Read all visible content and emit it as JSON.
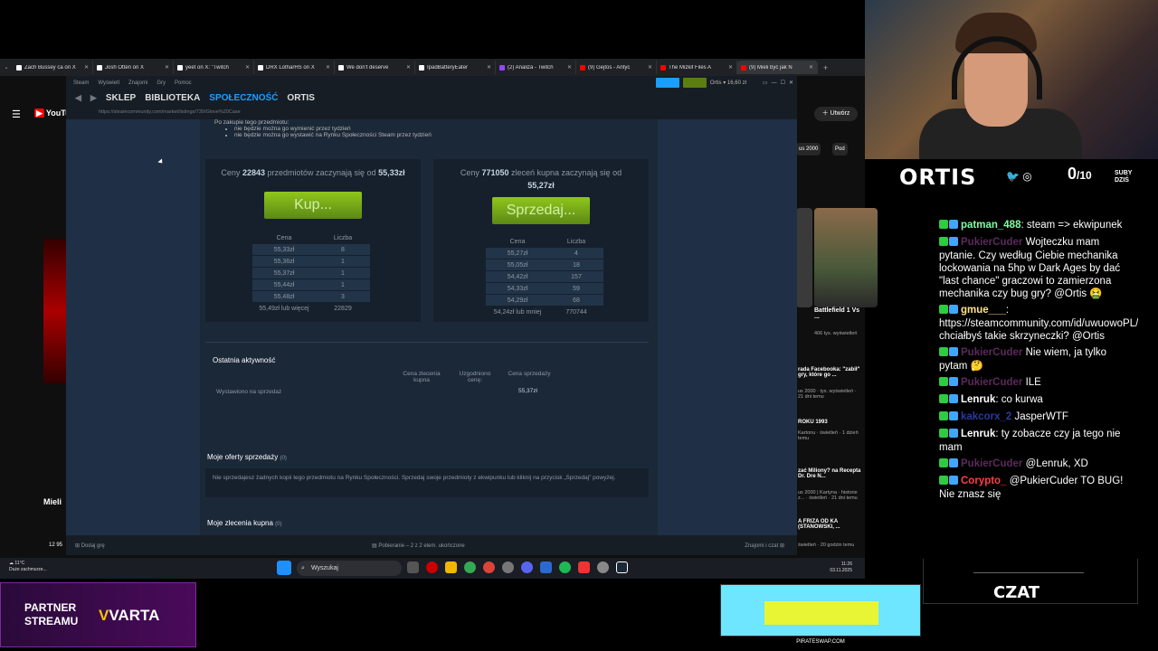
{
  "browser": {
    "tabs": [
      {
        "label": "Zach Bussey ca on X",
        "color": "#ffffff"
      },
      {
        "label": "Josh Otten on X",
        "color": "#ffffff"
      },
      {
        "label": "yeet on X: \"Twitch",
        "color": "#ffffff"
      },
      {
        "label": "DRX LotharHS on X",
        "color": "#ffffff"
      },
      {
        "label": "We don't deserve",
        "color": "#ffffff"
      },
      {
        "label": "IpadBatteryEater",
        "color": "#ffffff"
      },
      {
        "label": "(2) Analiza - Twitch",
        "color": "#9146ff"
      },
      {
        "label": "(9) Gejtos - Antyc",
        "color": "#ff0000"
      },
      {
        "label": "The Mizkif Files A",
        "color": "#ff0000"
      },
      {
        "label": "(9) Mieli być jak N",
        "color": "#ff0000"
      }
    ],
    "new_tab": "+"
  },
  "youtube": {
    "logo": "YouTube",
    "create_label": "Utwórz",
    "chip1": "us 2000",
    "chip2": "Pod",
    "video_title_left": "Mieli",
    "views_left": "12 95",
    "right_videos": [
      {
        "title": "Battlefield 1 Vs ...",
        "meta": "406 tys. wyświetleń"
      },
      {
        "title": "rada Facebooka: \"zabił\" gry, które go ...",
        "meta": "us 2000 · tys. wyświetleń · 21 dni temu"
      },
      {
        "title": "ROKU 1993",
        "meta": "Kartonu · świetleń · 1 dzień temu"
      },
      {
        "title": "zać Miliony? na Recepta Dr. Dre N...",
        "meta": "us 2000 | Kartyna · historie z... · świetleń · 21 dni temu"
      },
      {
        "title": "A FRIZA OD KA (STANOWSKI, ...",
        "meta": "świetleń · 20 godzin temu"
      }
    ]
  },
  "steam": {
    "menu": [
      "Steam",
      "Wyświetl",
      "Znajomi",
      "Gry",
      "Pomoc"
    ],
    "nav": [
      "SKLEP",
      "BIBLIOTEKA",
      "SPOŁECZNOŚĆ",
      "ORTIS"
    ],
    "active_nav": "SPOŁECZNOŚĆ",
    "wallet": "Ortis ▾ 16,60 zł",
    "url": "https://steamcommunity.com/market/listings/730/Glove%20Case",
    "notice_head": "Po zakupie tego przedmiotu:",
    "notice_items": [
      "nie będzie można go wymienić przez tydzień",
      "nie będzie można go wystawić na Rynku Społeczności Steam przez tydzień"
    ],
    "sell_box": {
      "prefix": "Ceny",
      "count": "22843",
      "middle": "przedmiotów zaczynają się od",
      "price": "55,33zł",
      "button": "Kup...",
      "col_price": "Cena",
      "col_qty": "Liczba",
      "rows": [
        {
          "price": "55,33zł",
          "qty": "8"
        },
        {
          "price": "55,36zł",
          "qty": "1"
        },
        {
          "price": "55,37zł",
          "qty": "1"
        },
        {
          "price": "55,44zł",
          "qty": "1"
        },
        {
          "price": "55,48zł",
          "qty": "3"
        }
      ],
      "last_price": "55,49zł lub więcej",
      "last_qty": "22829"
    },
    "buy_box": {
      "prefix": "Ceny",
      "count": "771050",
      "middle": "zleceń kupna zaczynają się od",
      "price": "55,27zł",
      "button": "Sprzedaj...",
      "col_price": "Cena",
      "col_qty": "Liczba",
      "rows": [
        {
          "price": "55,27zł",
          "qty": "4"
        },
        {
          "price": "55,05zł",
          "qty": "18"
        },
        {
          "price": "54,42zł",
          "qty": "157"
        },
        {
          "price": "54,33zł",
          "qty": "59"
        },
        {
          "price": "54,29zł",
          "qty": "68"
        }
      ],
      "last_price": "54,24zł lub mniej",
      "last_qty": "770744"
    },
    "activity": {
      "title": "Ostatnia aktywność",
      "col1": "Cena zlecenia kupna",
      "col2": "Uzgodniono cenę:",
      "col3": "Cena sprzedaży",
      "row_label": "Wystawiono na sprzedaż",
      "row_value": "55,37zł"
    },
    "my_listings": {
      "title": "Moje oferty sprzedaży",
      "count": "(0)",
      "text": "Nie sprzedajesz żadnych kopii tego przedmiotu na Rynku Społeczności. Sprzedaj swoje przedmioty z ekwipunku lub kliknij na przycisk „Sprzedaj” powyżej."
    },
    "my_orders": {
      "title": "Moje zlecenia kupna",
      "count": "(0)"
    },
    "bottom_add_game": "Dodaj grę",
    "bottom_download": "Pobieranie – 2 z 2 elem. ukończone",
    "bottom_friends": "Znajomi i czat"
  },
  "taskbar": {
    "weather_temp": "11°C",
    "weather_desc": "Duże zachmurze...",
    "search": "Wyszukaj",
    "time": "11:26",
    "date": "03.11.2025"
  },
  "stream": {
    "name": "ORTIS",
    "subs_current": "0",
    "subs_goal": "/10",
    "subs_label1": "SUBY",
    "subs_label2": "DZIŚ",
    "chat_label": "CZAT",
    "partner_line1": "PARTNER",
    "partner_line2": "STREAMU",
    "partner_brand": "VARTA",
    "ad_footer": "PIRATESWAP.COM",
    "chat": [
      {
        "user": "patman_488",
        "color": "#7fffa0",
        "sep": ":",
        "text": "steam => ekwipunek"
      },
      {
        "user": "PukierCuder",
        "color": "#5a2a5a",
        "sep": "",
        "text": "Wojteczku mam pytanie. Czy według Ciebie mechanika lockowania na 5hp w Dark Ages by dać \"last chance\" graczowi to zamierzona mechanika czy bug gry? @Ortis 🤮"
      },
      {
        "user": "gmue___",
        "color": "#ffe08a",
        "sep": ":",
        "text": "https://steamcommunity.com/id/uwuowoPL/inventory#730 chciałbyś takie skrzyneczki? @Ortis"
      },
      {
        "user": "PukierCuder",
        "color": "#5a2a5a",
        "sep": "",
        "text": "Nie wiem, ja tylko pytam 🤔"
      },
      {
        "user": "PukierCuder",
        "color": "#5a2a5a",
        "sep": "",
        "text": "ILE"
      },
      {
        "user": "Lenruk",
        "color": "#ffffff",
        "sep": ":",
        "text": "co kurwa"
      },
      {
        "user": "kakcorx_2",
        "color": "#2a3aa0",
        "sep": "",
        "text": "JasperWTF"
      },
      {
        "user": "Lenruk",
        "color": "#ffffff",
        "sep": ":",
        "text": "ty zobacze czy ja tego nie mam"
      },
      {
        "user": "PukierCuder",
        "color": "#5a2a5a",
        "sep": "",
        "text": "@Lenruk, XD"
      },
      {
        "user": "Corypto_",
        "color": "#ff4040",
        "sep": "",
        "text": "@PukierCuder TO BUG! Nie znasz się"
      }
    ]
  }
}
